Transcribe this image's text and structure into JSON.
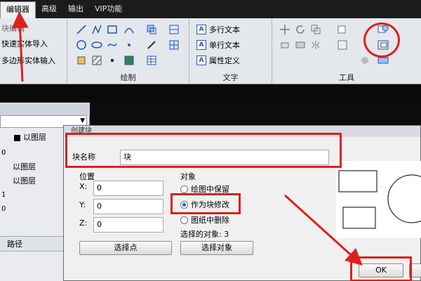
{
  "menubar": {
    "tabs": [
      "编辑器",
      "高级",
      "输出",
      "VIP功能"
    ],
    "active": "编辑器"
  },
  "ribbon": {
    "left_commands": [
      "块编辑",
      "快速实体导入",
      "多边形实体输入"
    ],
    "groups": {
      "draw": "绘制",
      "text": "文字",
      "tools": "工具"
    },
    "text_commands": [
      "多行文本",
      "单行文本",
      "属性定义"
    ]
  },
  "left_panel": {
    "layer_header": "以图层",
    "rows": [
      {
        "num": "0",
        "label": ""
      },
      {
        "num": "",
        "label": "以图层"
      },
      {
        "num": "",
        "label": "以图层"
      },
      {
        "num": "1",
        "label": ""
      },
      {
        "num": "0",
        "label": ""
      }
    ],
    "path_label": "路径"
  },
  "dialog": {
    "title": "创建块",
    "block_name_label": "块名称",
    "block_name_value": "块",
    "position_label": "位置",
    "x_label": "X:",
    "x_value": "0",
    "y_label": "Y:",
    "y_value": "0",
    "z_label": "Z:",
    "z_value": "0",
    "pick_point_button": "选择点",
    "objects_label": "对象",
    "radio_keep": "绘图中保留",
    "radio_convert": "作为块修改",
    "radio_delete": "图纸中删除",
    "selected_text": "选择的对象: 3",
    "select_objects_button": "选择对象",
    "ok_button": "OK"
  },
  "colors": {
    "highlight": "#d9221c",
    "ribbon": "#e4e7eb",
    "dialog": "#f0f0f0"
  },
  "icons": [
    "line-icon",
    "polyline-icon",
    "rectangle-icon",
    "arc-icon",
    "circle-icon",
    "ellipse-icon",
    "hatch-icon",
    "image-icon",
    "table-icon",
    "create-block-icon",
    "move-icon",
    "rotate-icon"
  ]
}
